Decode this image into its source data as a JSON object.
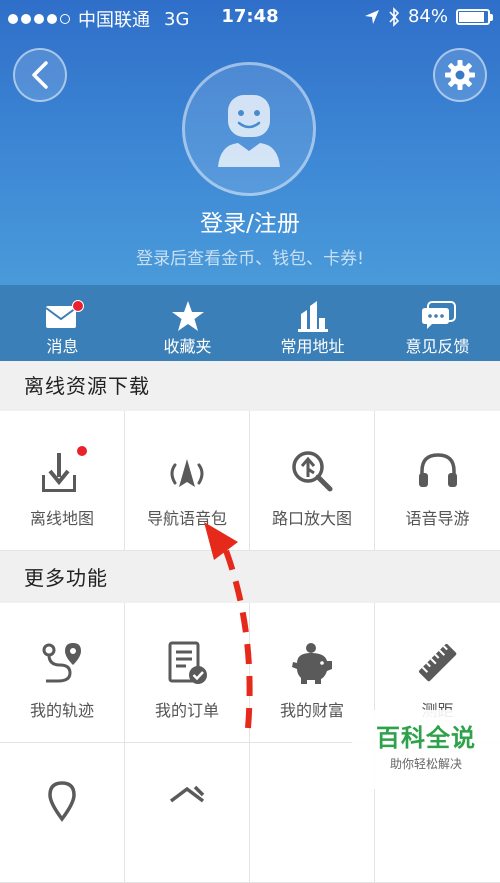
{
  "status_bar": {
    "carrier": "中国联通",
    "network": "3G",
    "time": "17:48",
    "battery": "84%",
    "battery_level": 0.84
  },
  "header": {
    "back_icon": "chevron-left-icon",
    "settings_icon": "gear-icon",
    "avatar_icon": "user-avatar-icon",
    "login_title": "登录/注册",
    "login_subtitle": "登录后查看金币、钱包、卡券!"
  },
  "quick_bar": {
    "items": [
      {
        "label": "消息",
        "icon": "envelope-icon",
        "badge": true
      },
      {
        "label": "收藏夹",
        "icon": "star-icon",
        "badge": false
      },
      {
        "label": "常用地址",
        "icon": "building-icon",
        "badge": false
      },
      {
        "label": "意见反馈",
        "icon": "chat-bubble-icon",
        "badge": false
      }
    ]
  },
  "offline_section": {
    "title": "离线资源下载",
    "items": [
      {
        "label": "离线地图",
        "icon": "download-icon",
        "badge": true
      },
      {
        "label": "导航语音包",
        "icon": "navigation-voice-icon",
        "badge": false
      },
      {
        "label": "路口放大图",
        "icon": "zoom-junction-icon",
        "badge": false
      },
      {
        "label": "语音导游",
        "icon": "headphones-icon",
        "badge": false
      }
    ]
  },
  "more_section": {
    "title": "更多功能",
    "items": [
      {
        "label": "我的轨迹",
        "icon": "route-pin-icon"
      },
      {
        "label": "我的订单",
        "icon": "order-list-icon"
      },
      {
        "label": "我的财富",
        "icon": "piggy-bank-icon"
      },
      {
        "label": "测距",
        "icon": "ruler-icon"
      }
    ]
  },
  "watermark": {
    "title": "百科全说",
    "subtitle": "助你轻松解决"
  },
  "colors": {
    "header_top": "#2f6fc9",
    "header_bottom": "#4a9ad9",
    "quick_bar": "#3a7fb7",
    "badge": "#e8212d",
    "icon_gray": "#5a5a5a",
    "annotation_arrow": "#e52a1c",
    "watermark_green": "#2ea24a"
  }
}
